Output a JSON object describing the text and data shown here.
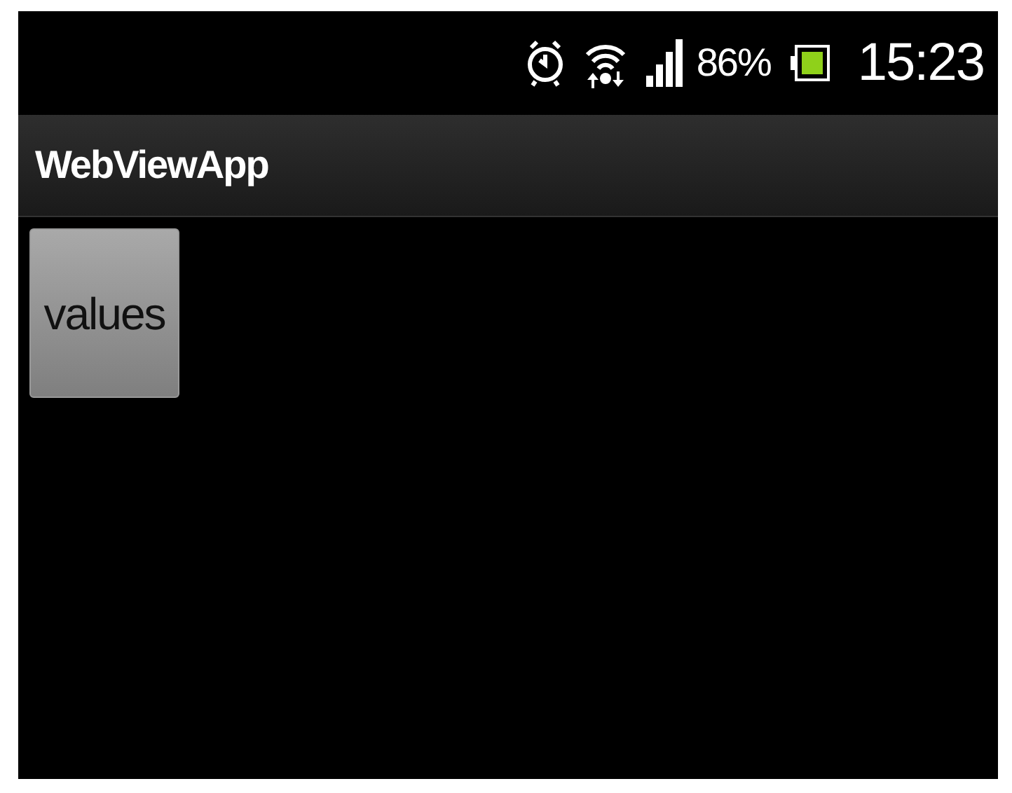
{
  "status_bar": {
    "battery": "86%",
    "time": "15:23"
  },
  "title_bar": {
    "title": "WebViewApp"
  },
  "buttons": [
    {
      "label": "values"
    }
  ]
}
